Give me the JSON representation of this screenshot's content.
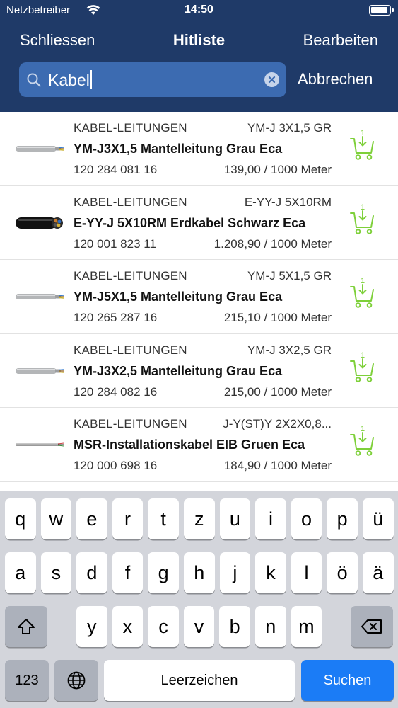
{
  "status_bar": {
    "carrier": "Netzbetreiber",
    "time": "14:50"
  },
  "nav": {
    "left": "Schliessen",
    "title": "Hitliste",
    "right": "Bearbeiten"
  },
  "search": {
    "value": "Kabel",
    "cancel": "Abbrechen"
  },
  "colors": {
    "header": "#1f3a68",
    "search_field": "#3c6bb1",
    "cart_green": "#7ed03a",
    "return_key": "#1b7cf6"
  },
  "results": [
    {
      "category": "KABEL-LEITUNGEN",
      "code": "YM-J 3X1,5 GR",
      "name": "YM-J3X1,5 Mantelleitung Grau Eca",
      "article_no": "120 284 081 16",
      "price": "139,00 / 1000 Meter",
      "image": "grey-cable"
    },
    {
      "category": "KABEL-LEITUNGEN",
      "code": "E-YY-J 5X10RM",
      "name": "E-YY-J 5X10RM Erdkabel Schwarz Eca",
      "article_no": "120 001 823 11",
      "price": "1.208,90 / 1000 Meter",
      "image": "black-cable"
    },
    {
      "category": "KABEL-LEITUNGEN",
      "code": "YM-J 5X1,5 GR",
      "name": "YM-J5X1,5 Mantelleitung Grau Eca",
      "article_no": "120 265 287 16",
      "price": "215,10 / 1000 Meter",
      "image": "grey-cable"
    },
    {
      "category": "KABEL-LEITUNGEN",
      "code": "YM-J 3X2,5 GR",
      "name": "YM-J3X2,5 Mantelleitung Grau Eca",
      "article_no": "120 284 082 16",
      "price": "215,00 / 1000 Meter",
      "image": "grey-cable"
    },
    {
      "category": "KABEL-LEITUNGEN",
      "code": "J-Y(ST)Y 2X2X0,8...",
      "name": "MSR-Installationskabel EIB Gruen Eca",
      "article_no": "120 000 698 16",
      "price": "184,90 / 1000 Meter",
      "image": "thin-cable"
    }
  ],
  "cart_badge": "1",
  "keyboard": {
    "row1": [
      "q",
      "w",
      "e",
      "r",
      "t",
      "z",
      "u",
      "i",
      "o",
      "p",
      "ü"
    ],
    "row2": [
      "a",
      "s",
      "d",
      "f",
      "g",
      "h",
      "j",
      "k",
      "l",
      "ö",
      "ä"
    ],
    "row3": [
      "y",
      "x",
      "c",
      "v",
      "b",
      "n",
      "m"
    ],
    "numbers_key": "123",
    "space_key": "Leerzeichen",
    "return_key": "Suchen",
    "icons": {
      "shift": "shift-icon",
      "delete": "backspace-icon",
      "globe": "globe-icon"
    }
  }
}
